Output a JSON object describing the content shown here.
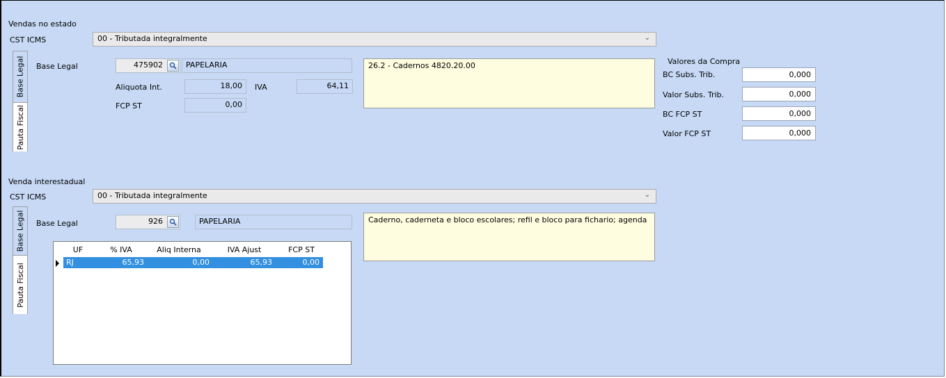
{
  "state": {
    "section_title": "Vendas no estado",
    "cst_label": "CST ICMS",
    "cst_value": "00 - Tributada integralmente",
    "tabs": [
      "Base Legal",
      "Pauta Fiscal"
    ],
    "base_legal_label": "Base Legal",
    "base_legal_code": "475902",
    "base_legal_desc": "PAPELARIA",
    "aliquota_label": "Aliquota Int.",
    "aliquota_value": "18,00",
    "iva_label": "IVA",
    "iva_value": "64,11",
    "fcp_label": "FCP ST",
    "fcp_value": "0,00",
    "note": "26.2 - Cadernos 4820.20.00"
  },
  "compra": {
    "title": "Valores da Compra",
    "rows": [
      {
        "label": "BC Subs. Trib.",
        "value": "0,000"
      },
      {
        "label": "Valor Subs. Trib.",
        "value": "0,000"
      },
      {
        "label": "BC FCP ST",
        "value": "0,000"
      },
      {
        "label": "Valor FCP ST",
        "value": "0,000"
      }
    ]
  },
  "inter": {
    "section_title": "Venda interestadual",
    "cst_label": "CST ICMS",
    "cst_value": "00 - Tributada integralmente",
    "tabs": [
      "Base Legal",
      "Pauta Fiscal"
    ],
    "base_legal_label": "Base Legal",
    "base_legal_code": "926",
    "base_legal_desc": "PAPELARIA",
    "note": "Caderno, caderneta e bloco escolares; refil e bloco para fichario; agenda",
    "grid": {
      "columns": [
        "UF",
        "% IVA",
        "Aliq Interna",
        "IVA Ajust",
        "FCP ST"
      ],
      "rows": [
        {
          "uf": "RJ",
          "iva": "65,93",
          "aliq": "0,00",
          "iva_ajust": "65,93",
          "fcp": "0,00"
        }
      ]
    }
  },
  "colors": {
    "panel_bg": "#c7d9f5",
    "note_bg": "#fefde0",
    "selected_row": "#3390e0"
  }
}
